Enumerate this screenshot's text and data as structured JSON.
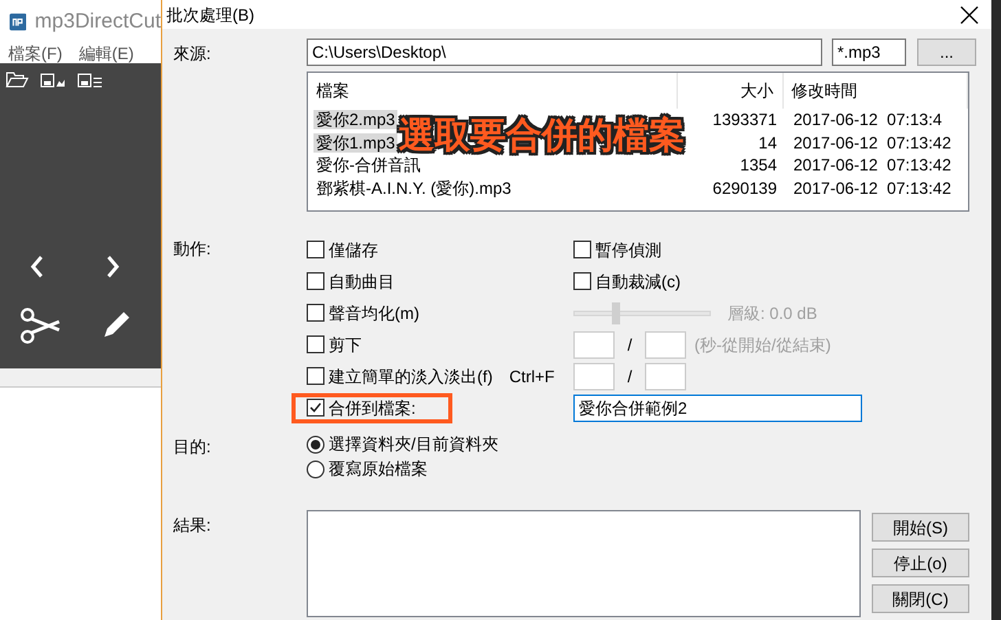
{
  "app": {
    "title": "mp3DirectCut",
    "menu": [
      "檔案(F)",
      "編輯(E)"
    ]
  },
  "dialog": {
    "title": "批次處理(B)",
    "source": {
      "label": "來源:",
      "path": "C:\\Users\\Desktop\\",
      "filter": "*.mp3",
      "browse_button": "..."
    },
    "file_list": {
      "columns": [
        "檔案",
        "大小",
        "修改時間"
      ],
      "rows": [
        {
          "name": "愛你2.mp3",
          "size": "1393371",
          "modified": "2017-06-12  07:13:4",
          "selected": true
        },
        {
          "name": "愛你1.mp3",
          "size": "14",
          "modified": "2017-06-12  07:13:42",
          "selected": true
        },
        {
          "name": "愛你-合併音訊",
          "size": "1354",
          "modified": "2017-06-12  07:13:42",
          "selected": false
        },
        {
          "name": "鄧紫棋-A.I.N.Y. (愛你).mp3",
          "size": "6290139",
          "modified": "2017-06-12  07:13:42",
          "selected": false
        }
      ]
    },
    "annotation": "選取要合併的檔案",
    "actions": {
      "label": "動作:",
      "save_only": {
        "label": "僅儲存",
        "checked": false
      },
      "pause_detect": {
        "label": "暫停偵測",
        "checked": false
      },
      "auto_track": {
        "label": "自動曲目",
        "checked": false
      },
      "auto_crop": {
        "label": "自動裁減(c)",
        "checked": false
      },
      "normalize": {
        "label": "聲音均化(m)",
        "checked": false
      },
      "level_slider": {
        "level": 0.3,
        "reading": "層級: 0.0 dB",
        "disabled": true
      },
      "cut": {
        "label": "剪下",
        "checked": false
      },
      "cut_hint": "(秒-從開始/從結束)",
      "fade": {
        "label": "建立簡單的淡入淡出(f)",
        "checked": false,
        "shortcut": "Ctrl+F"
      },
      "merge": {
        "label": "合併到檔案:",
        "checked": true,
        "highlighted": true,
        "filename": "愛你合併範例2"
      },
      "separator": "/"
    },
    "destination": {
      "label": "目的:",
      "options": [
        {
          "label": "選擇資料夾/目前資料夾",
          "selected": true
        },
        {
          "label": "覆寫原始檔案",
          "selected": false
        }
      ]
    },
    "result": {
      "label": "結果:"
    },
    "buttons": [
      "開始(S)",
      "停止(o)",
      "關閉(C)"
    ]
  }
}
